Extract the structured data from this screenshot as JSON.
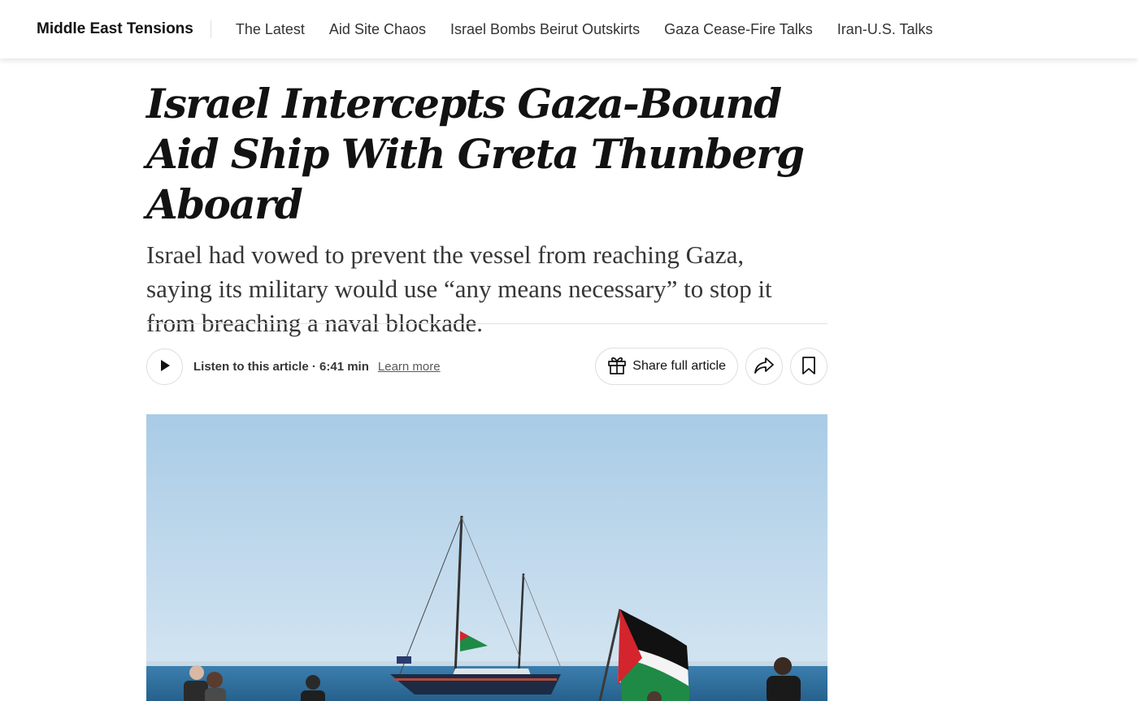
{
  "topnav": {
    "section_title": "Middle East Tensions",
    "links": [
      {
        "label": "The Latest"
      },
      {
        "label": "Aid Site Chaos"
      },
      {
        "label": "Israel Bombs Beirut Outskirts"
      },
      {
        "label": "Gaza Cease-Fire Talks"
      },
      {
        "label": "Iran-U.S. Talks"
      }
    ]
  },
  "article": {
    "headline": "Israel Intercepts Gaza-Bound Aid Ship With Greta Thunberg Aboard",
    "summary": "Israel had vowed to prevent the vessel from reaching Gaza, saying its military would use “any means necessary” to stop it from breaching a naval blockade."
  },
  "tools": {
    "play_icon": "play-icon",
    "listen_label": "Listen to this article · 6:41 min",
    "learn_more": "Learn more",
    "share_icon": "gift-icon",
    "share_label": "Share full article",
    "forward_icon": "share-arrow-icon",
    "bookmark_icon": "bookmark-icon"
  },
  "photo": {
    "subject": "sailboat-with-palestinian-flag",
    "colors": {
      "sky": "#b9d5ea",
      "sea": "#2f6f9c",
      "hull": "#1d2b44",
      "flag_black": "#111111",
      "flag_white": "#f4f4f4",
      "flag_green": "#1f8a45",
      "flag_red": "#d4242d"
    }
  }
}
